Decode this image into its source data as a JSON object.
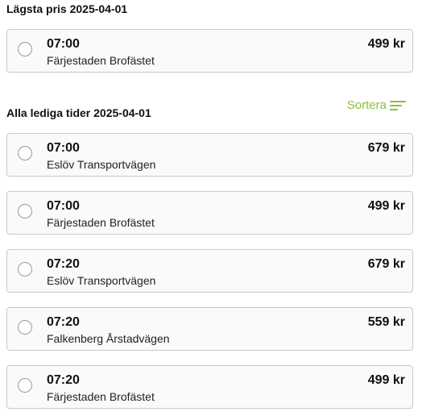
{
  "colors": {
    "accent": "#8cbf3c",
    "card_border": "#c9c9c9",
    "card_background": "#fafafa"
  },
  "cheapest": {
    "heading": "Lägsta pris 2025-04-01",
    "slot": {
      "time": "07:00",
      "location": "Färjestaden Brofästet",
      "price": "499 kr"
    }
  },
  "all": {
    "heading": "Alla lediga tider 2025-04-01",
    "sort_label": "Sortera",
    "sort_icon": "sort-lines-icon",
    "slots": [
      {
        "time": "07:00",
        "location": "Eslöv Transportvägen",
        "price": "679 kr"
      },
      {
        "time": "07:00",
        "location": "Färjestaden Brofästet",
        "price": "499 kr"
      },
      {
        "time": "07:20",
        "location": "Eslöv Transportvägen",
        "price": "679 kr"
      },
      {
        "time": "07:20",
        "location": "Falkenberg Årstadvägen",
        "price": "559 kr"
      },
      {
        "time": "07:20",
        "location": "Färjestaden Brofästet",
        "price": "499 kr"
      }
    ]
  }
}
